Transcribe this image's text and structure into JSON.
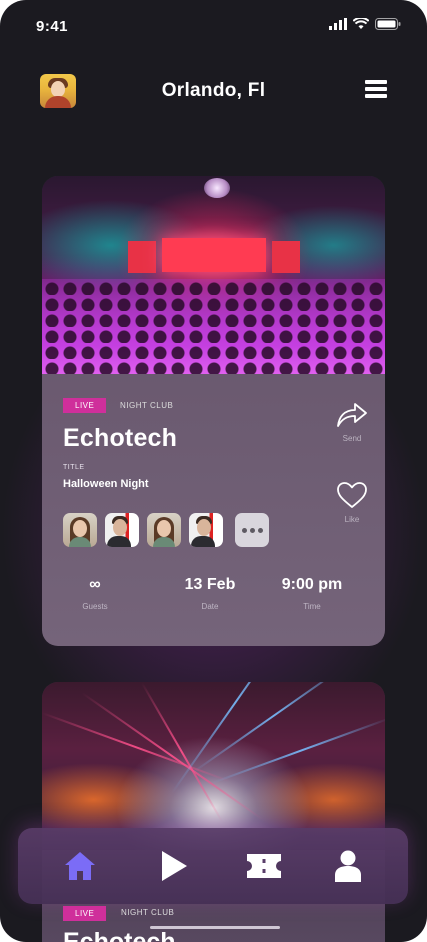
{
  "status": {
    "time": "9:41"
  },
  "header": {
    "city": "Orlando, Fl"
  },
  "event1": {
    "live": "LIVE",
    "category": "NIGHT CLUB",
    "name": "Echotech",
    "title_label": "TITLE",
    "title": "Halloween Night",
    "send_label": "Send",
    "like_label": "Like",
    "stats": [
      {
        "value": "∞",
        "label": "Guests"
      },
      {
        "value": "13 Feb",
        "label": "Date"
      },
      {
        "value": "9:00 pm",
        "label": "Time"
      }
    ]
  },
  "event2": {
    "live": "LIVE",
    "category": "NIGHT CLUB",
    "name": "Echotech"
  },
  "nav": {
    "items": [
      "home-icon",
      "play-icon",
      "ticket-icon",
      "profile-icon"
    ],
    "active": "home"
  },
  "colors": {
    "background": "#1b1a20",
    "accent": "#cf2f9b",
    "active_nav": "#7b6cf6"
  }
}
